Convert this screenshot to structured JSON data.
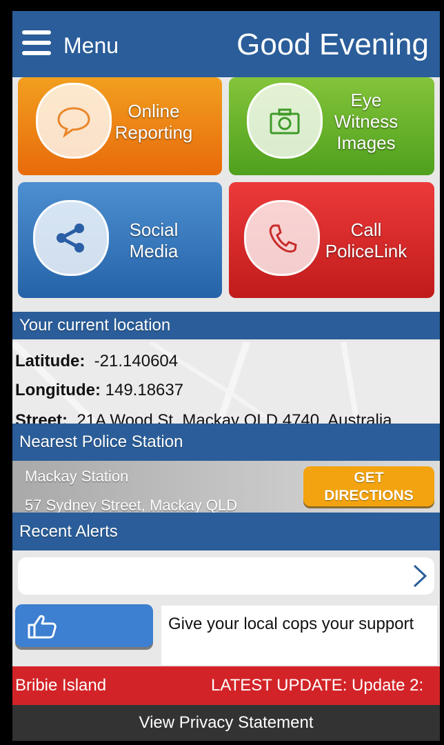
{
  "header": {
    "menu_label": "Menu",
    "greeting": "Good Evening"
  },
  "tiles": [
    {
      "label_line1": "Online",
      "label_line2": "Reporting",
      "icon": "speech-bubble-icon",
      "color": "#e86a0b"
    },
    {
      "label_line1": "Eye",
      "label_line2": "Witness",
      "label_line3": "Images",
      "icon": "camera-icon",
      "color": "#4fa01e"
    },
    {
      "label_line1": "Social",
      "label_line2": "Media",
      "icon": "share-icon",
      "color": "#2563a9"
    },
    {
      "label_line1": "Call",
      "label_line2": "PoliceLink",
      "icon": "phone-icon",
      "color": "#c11b1b"
    }
  ],
  "location": {
    "title": "Your current location",
    "latitude_label": "Latitude:",
    "latitude_value": "-21.140604",
    "longitude_label": "Longitude:",
    "longitude_value": "149.18637",
    "street_label": "Street:",
    "street_value": "21A Wood St, Mackay QLD 4740, Australia"
  },
  "station": {
    "title": "Nearest Police Station",
    "name": "Mackay Station",
    "address": "57 Sydney Street, Mackay QLD",
    "directions_line1": "GET",
    "directions_line2": "DIRECTIONS"
  },
  "alerts": {
    "title": "Recent Alerts"
  },
  "support": {
    "text": "Give your local cops your support"
  },
  "ticker": {
    "left_text": "Bribie Island",
    "right_text": "LATEST UPDATE: Update 2:"
  },
  "footer": {
    "privacy_label": "View Privacy Statement"
  },
  "colors": {
    "header_blue": "#2a5d99",
    "ticker_red": "#d22428",
    "footer": "#333333"
  }
}
